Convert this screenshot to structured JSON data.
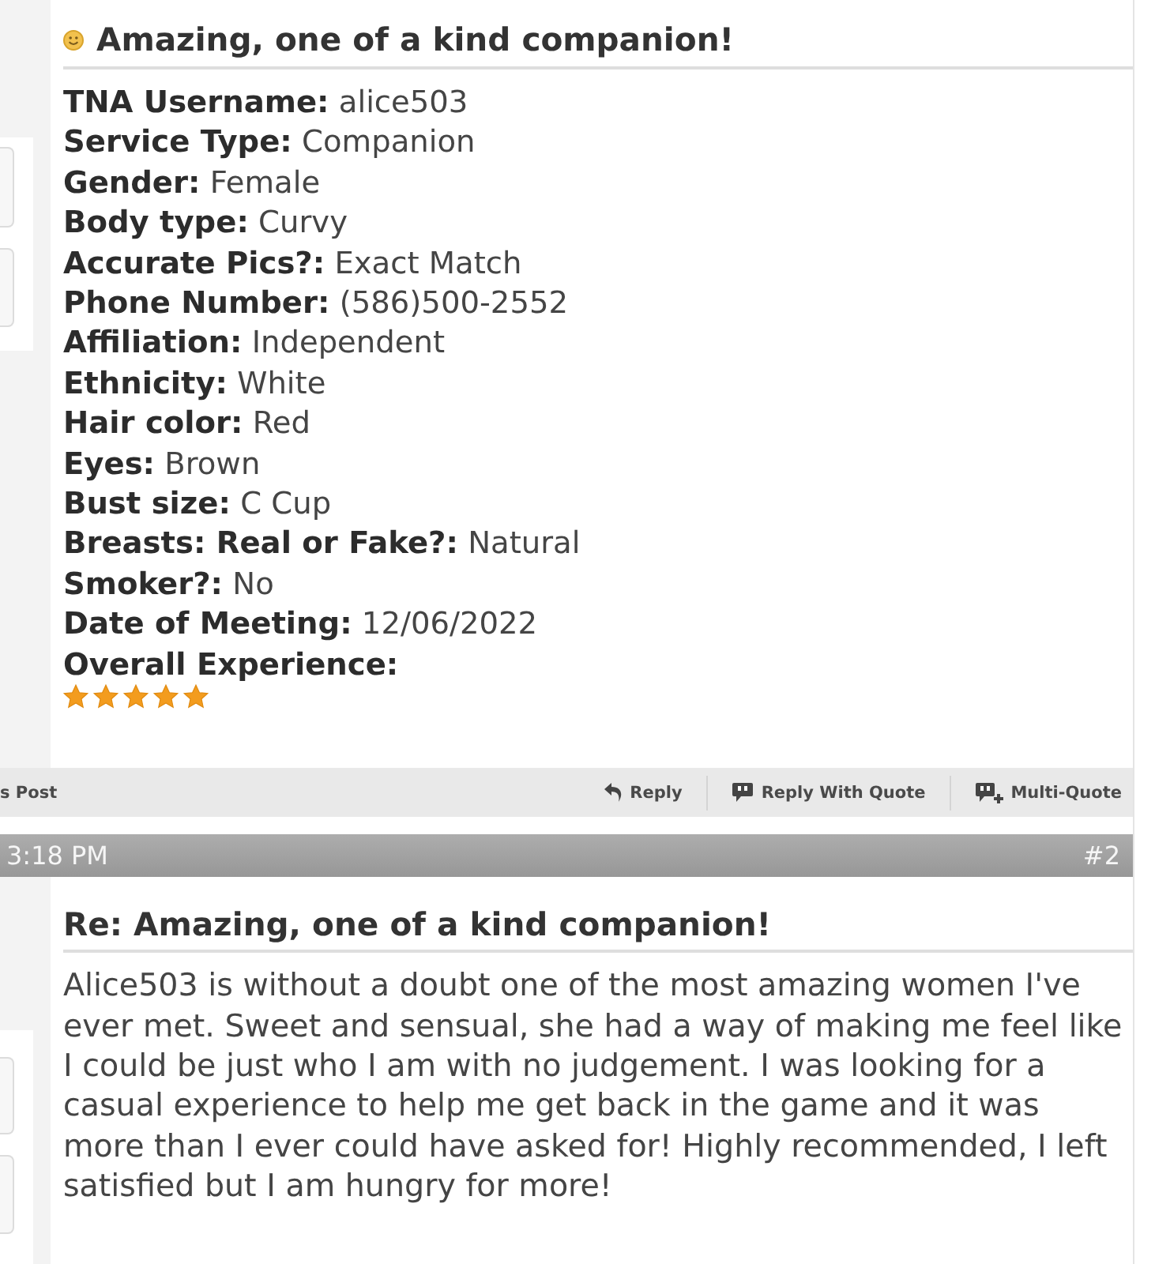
{
  "review_post": {
    "title": "Amazing, one of a kind companion!",
    "fields": [
      {
        "label": "TNA Username:",
        "value": "alice503"
      },
      {
        "label": "Service Type:",
        "value": "Companion"
      },
      {
        "label": "Gender:",
        "value": "Female"
      },
      {
        "label": "Body type:",
        "value": "Curvy"
      },
      {
        "label": "Accurate Pics?:",
        "value": "Exact Match"
      },
      {
        "label": "Phone Number:",
        "value": "(586)500-2552"
      },
      {
        "label": "Affiliation:",
        "value": "Independent"
      },
      {
        "label": "Ethnicity:",
        "value": "White"
      },
      {
        "label": "Hair color:",
        "value": "Red"
      },
      {
        "label": "Eyes:",
        "value": "Brown"
      },
      {
        "label": "Bust size:",
        "value": "C Cup"
      },
      {
        "label": "Breasts: Real or Fake?:",
        "value": "Natural"
      },
      {
        "label": "Smoker?:",
        "value": "No"
      },
      {
        "label": "Date of Meeting:",
        "value": "12/06/2022"
      }
    ],
    "rating": {
      "label": "Overall Experience:",
      "stars": 5
    }
  },
  "post_actions": {
    "left_link": "s Post",
    "buttons": [
      {
        "kind": "reply",
        "label": "Reply"
      },
      {
        "kind": "quote",
        "label": "Reply With Quote"
      },
      {
        "kind": "multiquote",
        "label": "Multi-Quote"
      }
    ]
  },
  "next_post": {
    "header": {
      "time": "3:18 PM",
      "number": "#2"
    },
    "title": "Re: Amazing, one of a kind companion!",
    "body": "Alice503 is without a doubt one of the most amazing women I've ever met. Sweet and sensual, she had a way of making me feel like I could be just who I am with no judgement. I was looking for a casual experience to help me get back in the game and it was more than I ever could have asked for! Highly recommended, I left satisfied but I am hungry for more!"
  }
}
